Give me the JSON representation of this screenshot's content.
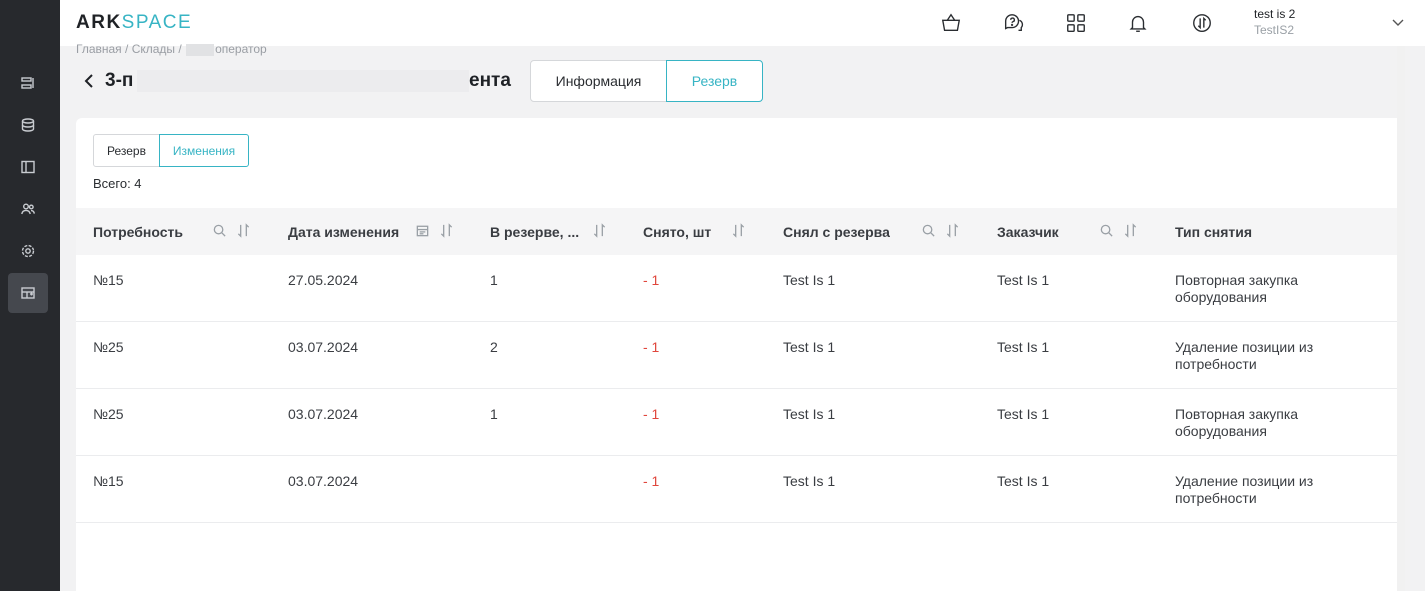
{
  "header": {
    "logo_part1": "ARK",
    "logo_part2": "SPACE",
    "user_name": "test is 2",
    "user_org": "TestIS2"
  },
  "breadcrumb": {
    "item1": "Главная",
    "item2": "Склады",
    "item3": "оператор",
    "sep": " / "
  },
  "page": {
    "title_start": "3-п",
    "title_end": "ента",
    "tabs": [
      "Информация",
      "Резерв"
    ]
  },
  "subtabs": [
    "Резерв",
    "Изменения"
  ],
  "total": "Всего: 4",
  "table": {
    "headers": [
      "Потребность",
      "Дата изменения",
      "В резерве, ...",
      "Снято, шт",
      "Снял с резерва",
      "Заказчик",
      "Тип снятия"
    ],
    "rows": [
      {
        "need": "№15",
        "date": "27.05.2024",
        "reserved": "1",
        "removed": "- 1",
        "by": "Test Is 1",
        "customer": "Test Is 1",
        "type": "Повторная закупка оборудования"
      },
      {
        "need": "№25",
        "date": "03.07.2024",
        "reserved": "2",
        "removed": "- 1",
        "by": "Test Is 1",
        "customer": "Test Is 1",
        "type": "Удаление позиции из потребности"
      },
      {
        "need": "№25",
        "date": "03.07.2024",
        "reserved": "1",
        "removed": "- 1",
        "by": "Test Is 1",
        "customer": "Test Is 1",
        "type": "Повторная закупка оборудования"
      },
      {
        "need": "№15",
        "date": "03.07.2024",
        "reserved": "",
        "removed": "- 1",
        "by": "Test Is 1",
        "customer": "Test Is 1",
        "type": "Удаление позиции из потребности"
      }
    ]
  },
  "icons": {
    "sidebar": [
      "list-icon",
      "database-icon",
      "book-icon",
      "users-icon",
      "settings-icon",
      "warehouse-icon"
    ],
    "header": [
      "basket-icon",
      "help-chat-icon",
      "apps-grid-icon",
      "bell-icon",
      "exchange-icon",
      "chevron-down-icon"
    ]
  },
  "colors": {
    "accent": "#37b4c4",
    "negative": "#e0463c",
    "sidebar": "#27292d"
  }
}
